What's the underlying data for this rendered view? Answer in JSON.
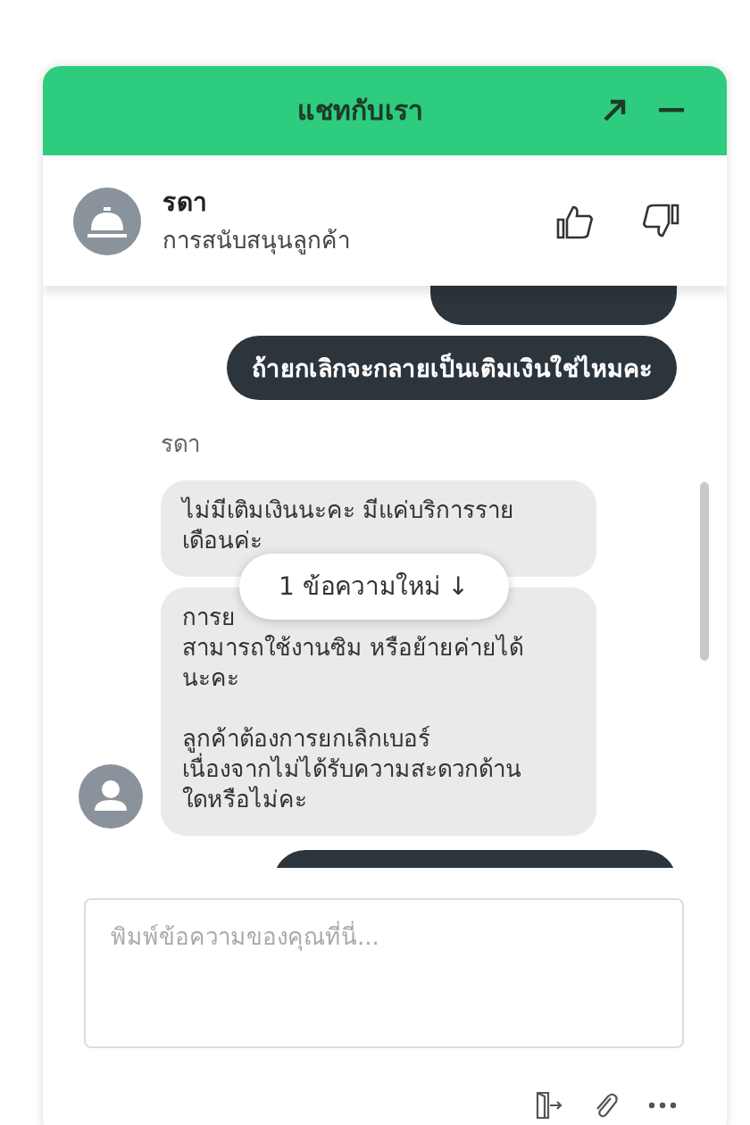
{
  "header": {
    "title": "แชทกับเรา"
  },
  "agent": {
    "name": "รดา",
    "role": "การสนับสนุนลูกค้า"
  },
  "messages": [
    {
      "kind": "clipped"
    },
    {
      "kind": "user",
      "paragraphs": [
        [
          "ถ้ายกเลิกจะกลายเป็นเติมเงินใช่ไหมคะ"
        ]
      ]
    },
    {
      "kind": "agent",
      "sender": "รดา",
      "paragraphs": [
        [
          "ไม่มีเติมเงินนะคะ มีแค่บริการราย",
          "เดือนค่ะ"
        ]
      ]
    },
    {
      "kind": "agent",
      "avatar": true,
      "paragraphs": [
        [
          "การย",
          "สามารถใช้งานซิม หรือย้ายค่ายได้",
          "นะคะ"
        ],
        [
          "ลูกค้าต้องการยกเลิกเบอร์",
          "เนื่องจากไม่ได้รับความสะดวกด้าน",
          "ใดหรือไม่คะ"
        ]
      ]
    },
    {
      "kind": "clipped"
    }
  ],
  "new_messages": {
    "label": "1 ข้อความใหม่ ↓"
  },
  "composer": {
    "placeholder": "พิมพ์ข้อความของคุณที่นี่..."
  }
}
